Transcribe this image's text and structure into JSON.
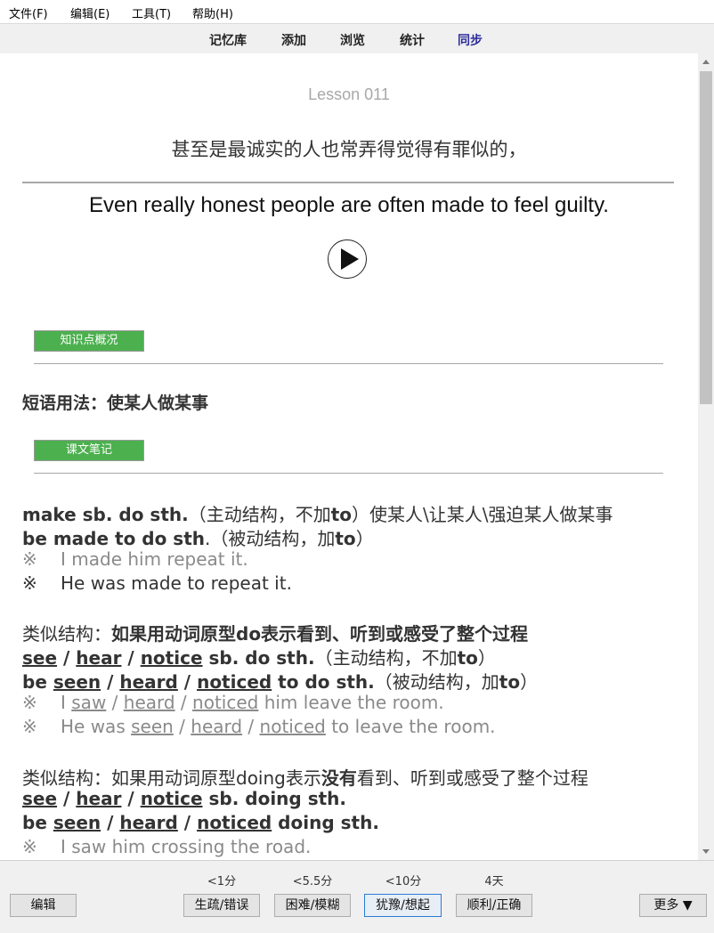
{
  "menu": {
    "file": "文件(F)",
    "edit": "编辑(E)",
    "tools": "工具(T)",
    "help": "帮助(H)"
  },
  "nav": {
    "deck": "记忆库",
    "add": "添加",
    "browse": "浏览",
    "stats": "统计",
    "sync": "同步"
  },
  "card": {
    "lesson": "Lesson 011",
    "question": "甚至是最诚实的人也常弄得觉得有罪似的，",
    "answer": "Even really honest people are often made to feel guilty.",
    "overview_button": "知识点概况",
    "overview_text": "短语用法：使某人做某事",
    "notes_button": "课文笔记",
    "notes": {
      "l1_b1": "make sb. do sth.",
      "l1_t1": "（主动结构，不加",
      "l1_b2": "to",
      "l1_t2": "）使某人\\让某人\\强迫某人做某事",
      "l2_b1": "be made to do sth",
      "l2_t1": ".（被动结构，加",
      "l2_b2": "to",
      "l2_t2": "）",
      "mark": "※",
      "ex1": "I made him repeat it.",
      "ex2": "He was made to repeat it.",
      "l3_t1": "类似结构：",
      "l3_b1": "如果用动词原型do表示看到、听到或感受了整个过程",
      "l4_see": "see",
      "l4_slash": " / ",
      "l4_hear": "hear",
      "l4_notice": "notice",
      "l4_b1": " sb. do sth.",
      "l4_t1": "（主动结构，不加",
      "l4_b2": "to",
      "l4_t2": "）",
      "l5_be": "be ",
      "l5_seen": "seen",
      "l5_heard": "heard",
      "l5_noticed": "noticed",
      "l5_b1": " to do sth.",
      "l5_t1": "（被动结构，加",
      "l5_b2": "to",
      "l5_t2": "）",
      "ex3_a": "I ",
      "ex3_saw": "saw",
      "ex3_heard": "heard",
      "ex3_noticed": "noticed",
      "ex3_b": " him leave the room.",
      "ex4_a": "He was ",
      "ex4_seen": "seen",
      "ex4_heard": "heard",
      "ex4_noticed": "noticed",
      "ex4_b": " to leave the room.",
      "l8_t1": "类似结构：如果用动词原型doing表示",
      "l8_b1": "没有",
      "l8_t2": "看到、听到或感受了整个过程",
      "l9_b1": " sb. doing sth.",
      "l10_b1": " doing sth.",
      "ex5": "I saw him crossing the road."
    }
  },
  "review": {
    "intervals": [
      "<1分",
      "<5.5分",
      "<10分",
      "4天"
    ],
    "edit": "编辑",
    "again": "生疏/错误",
    "hard": "困难/模糊",
    "good": "犹豫/想起",
    "easy": "顺利/正确",
    "more": "更多 ▼"
  }
}
